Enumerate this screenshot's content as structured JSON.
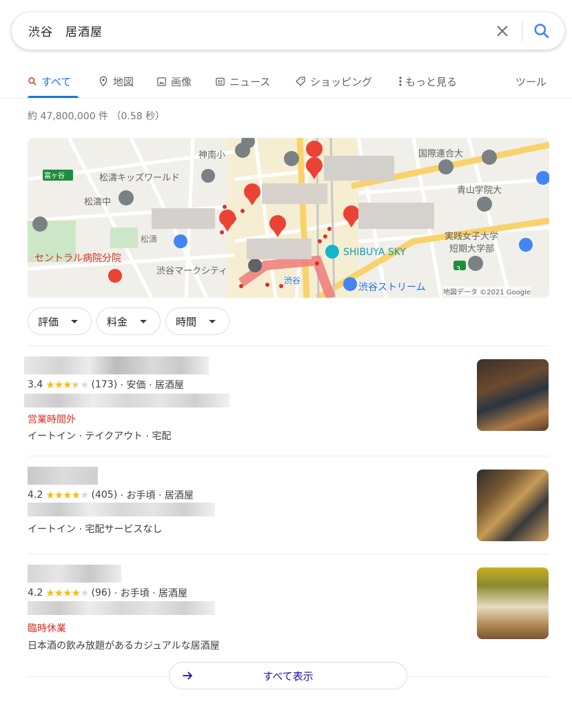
{
  "search": {
    "query": "渋谷　居酒屋"
  },
  "tabs": [
    {
      "label": "すべて",
      "icon": "search-icon",
      "active": true
    },
    {
      "label": "地図",
      "icon": "map-pin-icon"
    },
    {
      "label": "画像",
      "icon": "image-icon"
    },
    {
      "label": "ニュース",
      "icon": "news-icon"
    },
    {
      "label": "ショッピング",
      "icon": "tag-icon"
    },
    {
      "label": "もっと見る",
      "icon": "more-vert-icon"
    }
  ],
  "tools_label": "ツール",
  "stats": "約 47,800,000 件 （0.58 秒）",
  "map": {
    "labels": {
      "jinnan": "神南小",
      "kokusai": "国際連合大",
      "tomigaya": "富ヶ谷",
      "shotou_kids": "松濤キッズワールド",
      "aoyama": "青山学院大",
      "shotou_jr": "松濤中",
      "jissen1": "実践女子大学",
      "jissen2": "短期大学部",
      "shotou": "松濤",
      "shibuya_sky": "SHIBUYA SKY",
      "central": "セントラル病院分院",
      "mark_city": "渋谷マークシティ",
      "shibuya": "渋谷",
      "stream": "渋谷ストリーム",
      "route": "3"
    },
    "attribution": "地図データ ©2021 Google"
  },
  "filters": [
    "評価",
    "料金",
    "時間"
  ],
  "results": [
    {
      "rating": "3.4",
      "stars": 3.5,
      "count": "(173)",
      "meta": "· 安価 · 居酒屋",
      "status": "営業時間外",
      "desc": "イートイン · テイクアウト · 宅配"
    },
    {
      "rating": "4.2",
      "stars": 4,
      "count": "(405)",
      "meta": "· お手頃 · 居酒屋",
      "status": "",
      "desc": "イートイン · 宅配サービスなし"
    },
    {
      "rating": "4.2",
      "stars": 4,
      "count": "(96)",
      "meta": "· お手頃 · 居酒屋",
      "status": "臨時休業",
      "desc": "日本酒の飲み放題があるカジュアルな居酒屋"
    }
  ],
  "more_button": "すべて表示",
  "colors": {
    "accent": "#1a73e8",
    "closed": "#d93025",
    "star": "#fbbc04",
    "pin": "#ea4335"
  }
}
